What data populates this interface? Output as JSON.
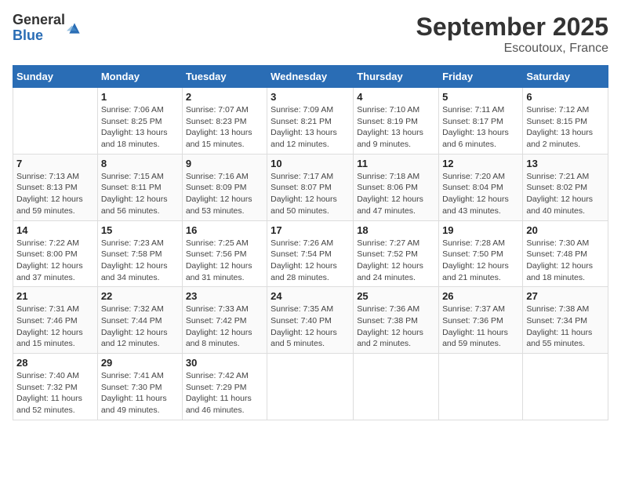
{
  "header": {
    "logo_general": "General",
    "logo_blue": "Blue",
    "month_title": "September 2025",
    "location": "Escoutoux, France"
  },
  "weekdays": [
    "Sunday",
    "Monday",
    "Tuesday",
    "Wednesday",
    "Thursday",
    "Friday",
    "Saturday"
  ],
  "weeks": [
    [
      {
        "day": "",
        "info": ""
      },
      {
        "day": "1",
        "info": "Sunrise: 7:06 AM\nSunset: 8:25 PM\nDaylight: 13 hours\nand 18 minutes."
      },
      {
        "day": "2",
        "info": "Sunrise: 7:07 AM\nSunset: 8:23 PM\nDaylight: 13 hours\nand 15 minutes."
      },
      {
        "day": "3",
        "info": "Sunrise: 7:09 AM\nSunset: 8:21 PM\nDaylight: 13 hours\nand 12 minutes."
      },
      {
        "day": "4",
        "info": "Sunrise: 7:10 AM\nSunset: 8:19 PM\nDaylight: 13 hours\nand 9 minutes."
      },
      {
        "day": "5",
        "info": "Sunrise: 7:11 AM\nSunset: 8:17 PM\nDaylight: 13 hours\nand 6 minutes."
      },
      {
        "day": "6",
        "info": "Sunrise: 7:12 AM\nSunset: 8:15 PM\nDaylight: 13 hours\nand 2 minutes."
      }
    ],
    [
      {
        "day": "7",
        "info": "Sunrise: 7:13 AM\nSunset: 8:13 PM\nDaylight: 12 hours\nand 59 minutes."
      },
      {
        "day": "8",
        "info": "Sunrise: 7:15 AM\nSunset: 8:11 PM\nDaylight: 12 hours\nand 56 minutes."
      },
      {
        "day": "9",
        "info": "Sunrise: 7:16 AM\nSunset: 8:09 PM\nDaylight: 12 hours\nand 53 minutes."
      },
      {
        "day": "10",
        "info": "Sunrise: 7:17 AM\nSunset: 8:07 PM\nDaylight: 12 hours\nand 50 minutes."
      },
      {
        "day": "11",
        "info": "Sunrise: 7:18 AM\nSunset: 8:06 PM\nDaylight: 12 hours\nand 47 minutes."
      },
      {
        "day": "12",
        "info": "Sunrise: 7:20 AM\nSunset: 8:04 PM\nDaylight: 12 hours\nand 43 minutes."
      },
      {
        "day": "13",
        "info": "Sunrise: 7:21 AM\nSunset: 8:02 PM\nDaylight: 12 hours\nand 40 minutes."
      }
    ],
    [
      {
        "day": "14",
        "info": "Sunrise: 7:22 AM\nSunset: 8:00 PM\nDaylight: 12 hours\nand 37 minutes."
      },
      {
        "day": "15",
        "info": "Sunrise: 7:23 AM\nSunset: 7:58 PM\nDaylight: 12 hours\nand 34 minutes."
      },
      {
        "day": "16",
        "info": "Sunrise: 7:25 AM\nSunset: 7:56 PM\nDaylight: 12 hours\nand 31 minutes."
      },
      {
        "day": "17",
        "info": "Sunrise: 7:26 AM\nSunset: 7:54 PM\nDaylight: 12 hours\nand 28 minutes."
      },
      {
        "day": "18",
        "info": "Sunrise: 7:27 AM\nSunset: 7:52 PM\nDaylight: 12 hours\nand 24 minutes."
      },
      {
        "day": "19",
        "info": "Sunrise: 7:28 AM\nSunset: 7:50 PM\nDaylight: 12 hours\nand 21 minutes."
      },
      {
        "day": "20",
        "info": "Sunrise: 7:30 AM\nSunset: 7:48 PM\nDaylight: 12 hours\nand 18 minutes."
      }
    ],
    [
      {
        "day": "21",
        "info": "Sunrise: 7:31 AM\nSunset: 7:46 PM\nDaylight: 12 hours\nand 15 minutes."
      },
      {
        "day": "22",
        "info": "Sunrise: 7:32 AM\nSunset: 7:44 PM\nDaylight: 12 hours\nand 12 minutes."
      },
      {
        "day": "23",
        "info": "Sunrise: 7:33 AM\nSunset: 7:42 PM\nDaylight: 12 hours\nand 8 minutes."
      },
      {
        "day": "24",
        "info": "Sunrise: 7:35 AM\nSunset: 7:40 PM\nDaylight: 12 hours\nand 5 minutes."
      },
      {
        "day": "25",
        "info": "Sunrise: 7:36 AM\nSunset: 7:38 PM\nDaylight: 12 hours\nand 2 minutes."
      },
      {
        "day": "26",
        "info": "Sunrise: 7:37 AM\nSunset: 7:36 PM\nDaylight: 11 hours\nand 59 minutes."
      },
      {
        "day": "27",
        "info": "Sunrise: 7:38 AM\nSunset: 7:34 PM\nDaylight: 11 hours\nand 55 minutes."
      }
    ],
    [
      {
        "day": "28",
        "info": "Sunrise: 7:40 AM\nSunset: 7:32 PM\nDaylight: 11 hours\nand 52 minutes."
      },
      {
        "day": "29",
        "info": "Sunrise: 7:41 AM\nSunset: 7:30 PM\nDaylight: 11 hours\nand 49 minutes."
      },
      {
        "day": "30",
        "info": "Sunrise: 7:42 AM\nSunset: 7:29 PM\nDaylight: 11 hours\nand 46 minutes."
      },
      {
        "day": "",
        "info": ""
      },
      {
        "day": "",
        "info": ""
      },
      {
        "day": "",
        "info": ""
      },
      {
        "day": "",
        "info": ""
      }
    ]
  ]
}
